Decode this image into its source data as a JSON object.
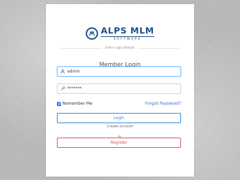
{
  "brand": {
    "name": "ALPS MLM",
    "tagline": "SOFTWARE",
    "color": "#1e4f8a"
  },
  "login_details_caption": "Enter Login Details",
  "title": "Member Login",
  "username": {
    "value": "admin",
    "icon": "user-icon"
  },
  "password": {
    "value": "*******",
    "icon": "key-icon"
  },
  "remember_me": {
    "label": "Remember Me",
    "checked": true
  },
  "forgot_password": "Forgot Password?",
  "login_button": "Login",
  "create_account_caption": "Create account",
  "register_button": "Register",
  "colors": {
    "login_accent": "#2b8be0",
    "register_accent": "#e0505f",
    "link": "#2e6fd1"
  }
}
